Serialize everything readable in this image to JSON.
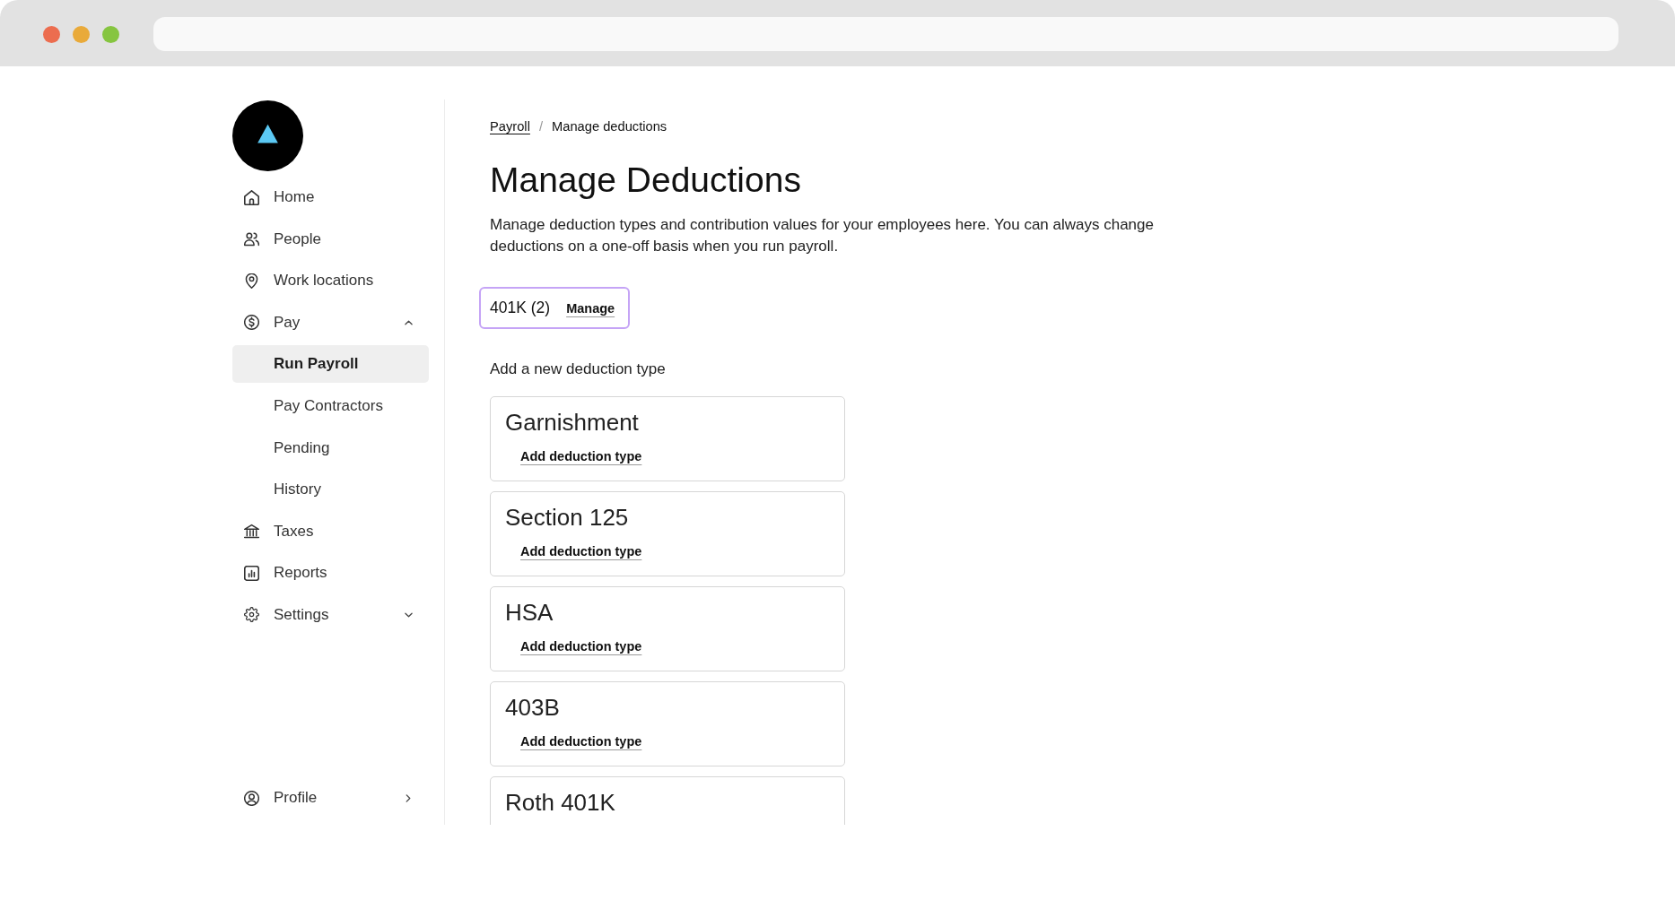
{
  "sidebar": {
    "items": [
      {
        "label": "Home",
        "kind": "link",
        "selected": false
      },
      {
        "label": "People",
        "kind": "link",
        "selected": false
      },
      {
        "label": "Work locations",
        "kind": "link",
        "selected": false
      },
      {
        "label": "Pay",
        "kind": "group",
        "selected": false,
        "expanded": true,
        "children": [
          {
            "label": "Run Payroll",
            "selected": true
          },
          {
            "label": "Pay Contractors",
            "selected": false
          },
          {
            "label": "Pending",
            "selected": false
          },
          {
            "label": "History",
            "selected": false
          }
        ]
      },
      {
        "label": "Taxes",
        "kind": "link",
        "selected": false
      },
      {
        "label": "Reports",
        "kind": "link",
        "selected": false
      },
      {
        "label": "Settings",
        "kind": "group",
        "selected": false,
        "expanded": false
      }
    ],
    "profile": {
      "label": "Profile",
      "selected": false
    }
  },
  "breadcrumb": {
    "separator": "/",
    "items": [
      {
        "label": "Payroll",
        "kind": "link"
      },
      {
        "label": "Manage deductions",
        "kind": "current"
      }
    ]
  },
  "title": "Manage Deductions",
  "description": "Manage deduction types and contribution values for your employees here. You can always change deductions on a one-off basis when you run payroll.",
  "active_deductions": [
    {
      "label": "401K (2)",
      "action": "Manage",
      "selected": true
    }
  ],
  "new_deduction": {
    "heading": "Add a new deduction type",
    "cards": [
      {
        "title": "Garnishment",
        "action": "Add deduction type"
      },
      {
        "title": "Section 125",
        "action": "Add deduction type"
      },
      {
        "title": "HSA",
        "action": "Add deduction type"
      },
      {
        "title": "403B",
        "action": "Add deduction type"
      },
      {
        "title": "Roth 401K"
      }
    ]
  }
}
